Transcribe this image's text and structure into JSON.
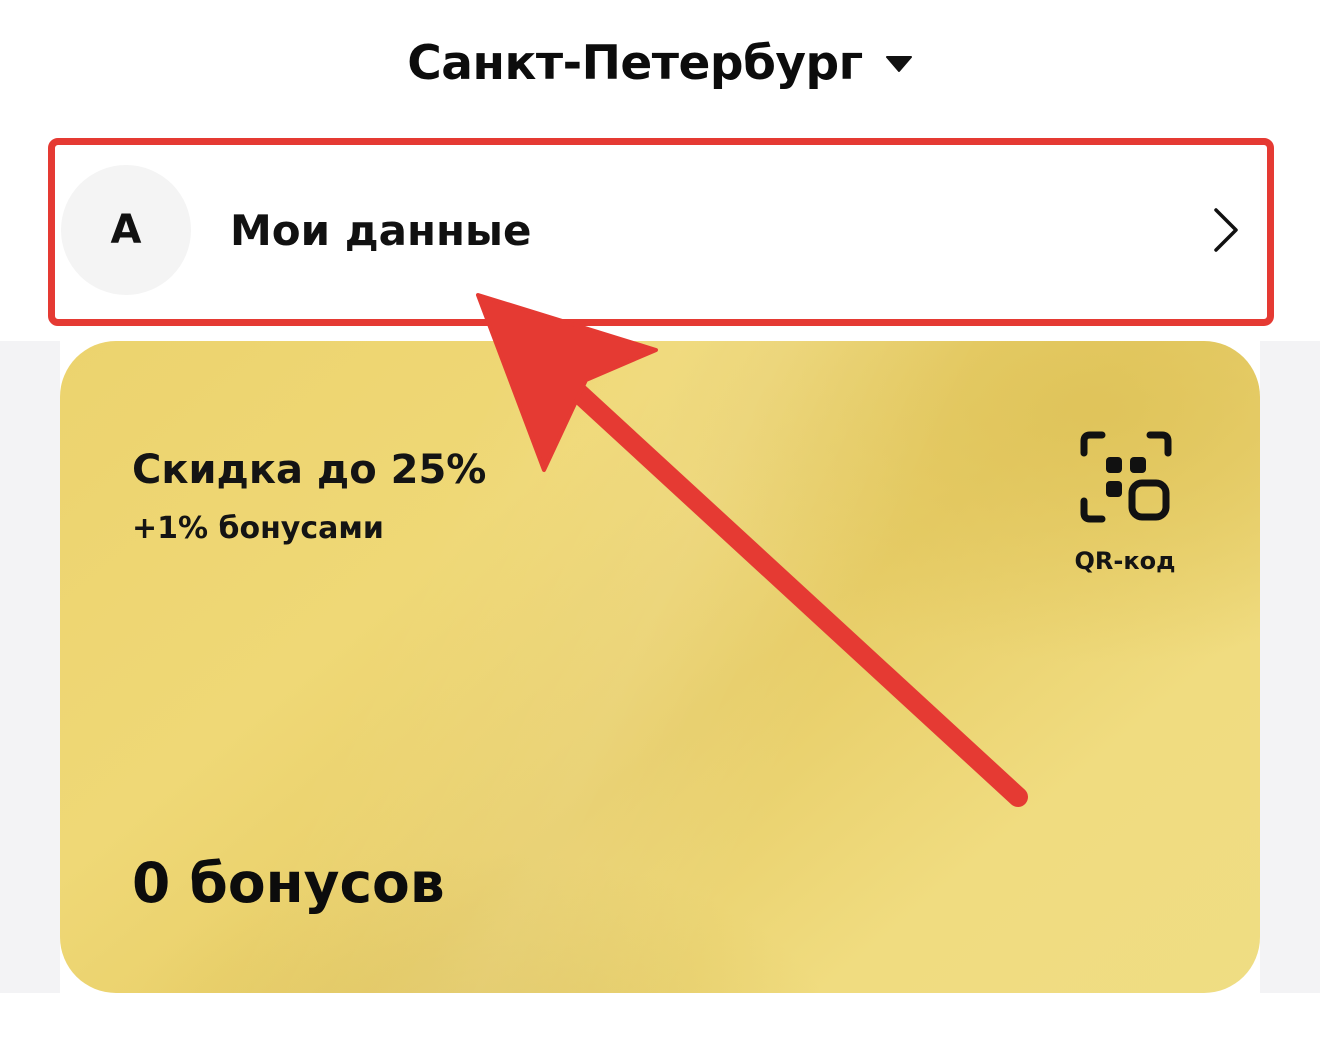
{
  "header": {
    "city_name": "Санкт-Петербург",
    "city_caret_icon": "caret-down-icon"
  },
  "profile": {
    "avatar_letter": "А",
    "label": "Мои данные",
    "chevron_icon": "chevron-right-icon"
  },
  "loyalty_card": {
    "discount_title": "Скидка до 25%",
    "bonus_subtitle": "+1% бонусами",
    "qr_label": "QR-код",
    "qr_icon": "qr-code-icon",
    "bonus_balance": "0 бонусов"
  },
  "colors": {
    "highlight_frame": "#e53a33",
    "annotation_arrow": "#e53a33",
    "card_gold": "#ecd36e",
    "text_dark": "#0c0c0c"
  }
}
